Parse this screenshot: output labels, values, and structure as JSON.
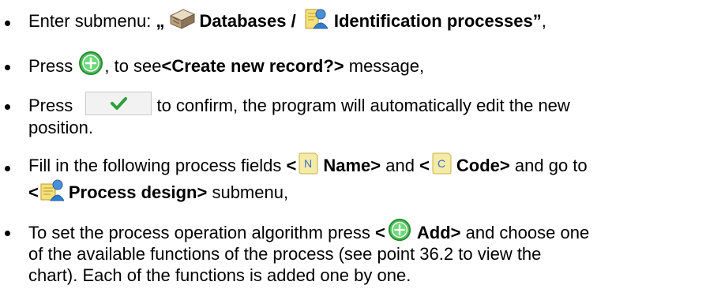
{
  "items": [
    {
      "pre": "Enter submenu: ",
      "quote_open": "„",
      "databases_label": "Databases / ",
      "identification_label": "Identification processes",
      "quote_close": "”",
      "post": ","
    },
    {
      "pre": "Press ",
      "mid": ", to see",
      "message": "<Create new record?>",
      "post": " message,"
    },
    {
      "pre": "Press ",
      "line1_post": " to confirm, the program will automatically edit the new",
      "line2": "position."
    },
    {
      "line1_pre": "Fill in the following process fields ",
      "lt1": "<",
      "name_field": "Name>",
      "and": " and ",
      "lt2": "<",
      "code_field": "Code>",
      "line1_post": " and go to",
      "lt3": "<",
      "design_submenu": "Process design>",
      "line2_post": " submenu,"
    },
    {
      "line1_pre": "To set the process operation algorithm press ",
      "lt": "<",
      "add_label": "Add>",
      "line1_post": " and choose one",
      "line2": "of the available functions of the process (see point 36.2 to view the",
      "line3": "chart). Each of the functions is added one by one."
    }
  ],
  "icons": {
    "database": "database-icon",
    "identification": "identification-process-icon",
    "add": "add-plus-icon",
    "confirm": "confirm-checkmark-icon",
    "name": "name-field-icon",
    "code": "code-field-icon",
    "process_design": "process-design-icon"
  },
  "colors": {
    "add_green": "#3cb04a",
    "check_green": "#2e9e3a",
    "field_icon": "#f3eba6"
  }
}
